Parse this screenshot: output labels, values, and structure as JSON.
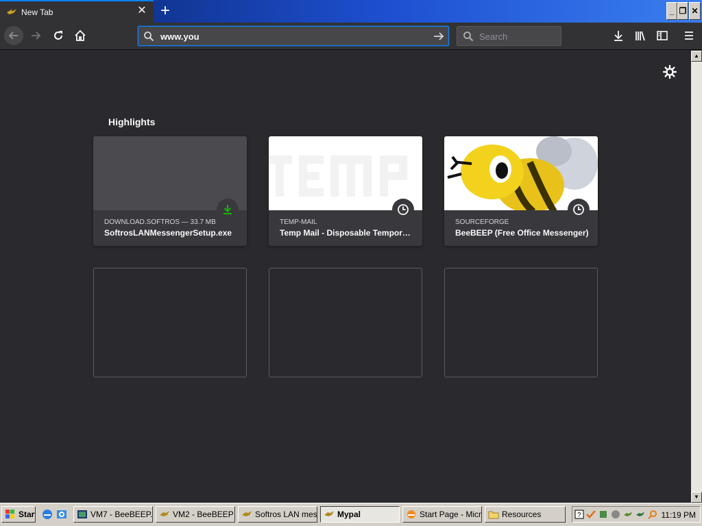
{
  "browser": {
    "tab": {
      "title": "New Tab"
    },
    "url_bar": {
      "value": "www.you"
    },
    "search_bar": {
      "placeholder": "Search"
    }
  },
  "highlights": {
    "title": "Highlights",
    "cards": [
      {
        "source": "DOWNLOAD.SOFTROS — 33.7 MB",
        "title": "SoftrosLANMessengerSetup.exe",
        "badge_icon": "download-icon"
      },
      {
        "source": "TEMP-MAIL",
        "title": "Temp Mail - Disposable Temporary Email",
        "badge_icon": "clock-icon"
      },
      {
        "source": "SOURCEFORGE",
        "title": "BeeBEEP (Free Office Messenger)",
        "badge_icon": "clock-icon"
      }
    ]
  },
  "taskbar": {
    "start_label": "Start",
    "buttons": [
      {
        "label": "VM7 - BeeBEEP..."
      },
      {
        "label": "VM2 - BeeBEEP"
      },
      {
        "label": "Softros LAN mes..."
      },
      {
        "label": "Mypal"
      },
      {
        "label": "Start Page - Micr..."
      },
      {
        "label": "Resources"
      }
    ],
    "clock": "11:19 PM"
  },
  "colors": {
    "accent": "#0a84ff",
    "page_bg": "#2a2a2e",
    "card_bg": "#38383d",
    "download_green": "#12bc00"
  }
}
